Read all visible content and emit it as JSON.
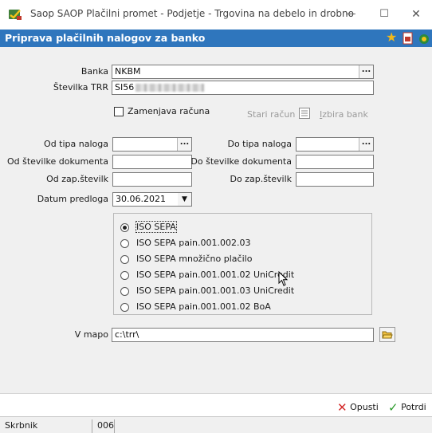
{
  "window": {
    "title": "Saop SAOP Plačilni promet - Podjetje - Trgovina na debelo in drobno",
    "minimize": "—",
    "maximize": "☐",
    "close": "✕"
  },
  "header": {
    "title": "Priprava plačilnih nalogov za banko",
    "icons": [
      "star-icon",
      "pdf-icon",
      "help-icon"
    ]
  },
  "form": {
    "banka_label": "Banka",
    "banka_value": "NKBM",
    "trr_label": "Številka TRR",
    "trr_value": "SI56",
    "zamenjava_label": "Zamenjava računa",
    "stari_racun": "Stari račun",
    "izbira_bank": "Izbira bank",
    "od_tipa_label": "Od tipa naloga",
    "do_tipa_label": "Do tipa naloga",
    "od_dok_label": "Od številke dokumenta",
    "do_dok_label": "Do številke dokumenta",
    "od_zap_label": "Od zap.številk",
    "do_zap_label": "Do zap.številk",
    "datum_label": "Datum predloga",
    "datum_value": "30.06.2021",
    "ellipsis": "...",
    "dropdown_arrow": "▼"
  },
  "formats": {
    "selected": "ISO SEPA",
    "options": [
      "ISO SEPA",
      "ISO SEPA pain.001.002.03",
      "ISO SEPA množično plačilo",
      "ISO SEPA pain.001.001.02 UniCredit",
      "ISO SEPA pain.001.001.03 UniCredit",
      "ISO SEPA pain.001.001.02 BoA"
    ]
  },
  "folder": {
    "label": "V mapo",
    "value": "c:\\trr\\"
  },
  "actions": {
    "cancel_label": "Opusti",
    "confirm_label": "Potrdi"
  },
  "status": {
    "user": "Skrbnik",
    "code": "006"
  },
  "colors": {
    "header_blue": "#2f76bd",
    "cancel_red": "#d42b2b",
    "confirm_green": "#2a9b2a"
  }
}
